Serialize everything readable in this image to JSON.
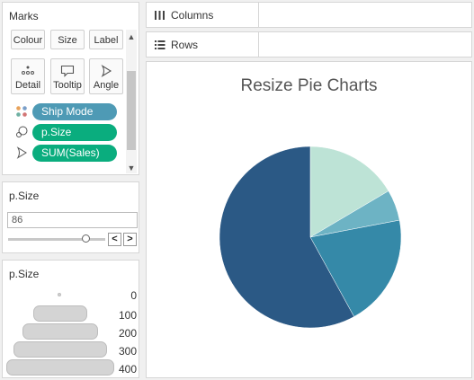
{
  "marks": {
    "title": "Marks",
    "buttons": [
      {
        "label": "Colour",
        "icon": "colour-icon"
      },
      {
        "label": "Size",
        "icon": "size-icon"
      },
      {
        "label": "Label",
        "icon": "label-icon"
      },
      {
        "label": "Detail",
        "icon": "detail-icon"
      },
      {
        "label": "Tooltip",
        "icon": "tooltip-icon"
      },
      {
        "label": "Angle",
        "icon": "angle-icon"
      }
    ],
    "fields": [
      {
        "label": "Ship Mode",
        "role": "colour",
        "icon": "colour-icon",
        "color": "#4e9ab5"
      },
      {
        "label": "p.Size",
        "role": "size",
        "icon": "size-icon",
        "color": "#0aad7e"
      },
      {
        "label": "SUM(Sales)",
        "role": "angle",
        "icon": "angle-icon",
        "color": "#0aad7e"
      }
    ]
  },
  "parameter": {
    "title": "p.Size",
    "value": "86",
    "slider_fraction": 0.215,
    "prev_label": "<",
    "next_label": ">"
  },
  "size_legend": {
    "title": "p.Size",
    "entries": [
      "0",
      "100",
      "200",
      "300",
      "400"
    ]
  },
  "shelves": {
    "columns_label": "Columns",
    "rows_label": "Rows"
  },
  "chart_data": {
    "type": "pie",
    "title": "Resize Pie Charts",
    "slices": [
      {
        "value": 16.5,
        "color": "#bde3d6"
      },
      {
        "value": 5.5,
        "color": "#6db3c4"
      },
      {
        "value": 20,
        "color": "#3589a8"
      },
      {
        "value": 58,
        "color": "#2b5985"
      }
    ]
  },
  "colors": {
    "pill_teal": "#4e9ab5",
    "pill_green": "#0aad7e",
    "legend_gray": "#d4d4d4"
  }
}
